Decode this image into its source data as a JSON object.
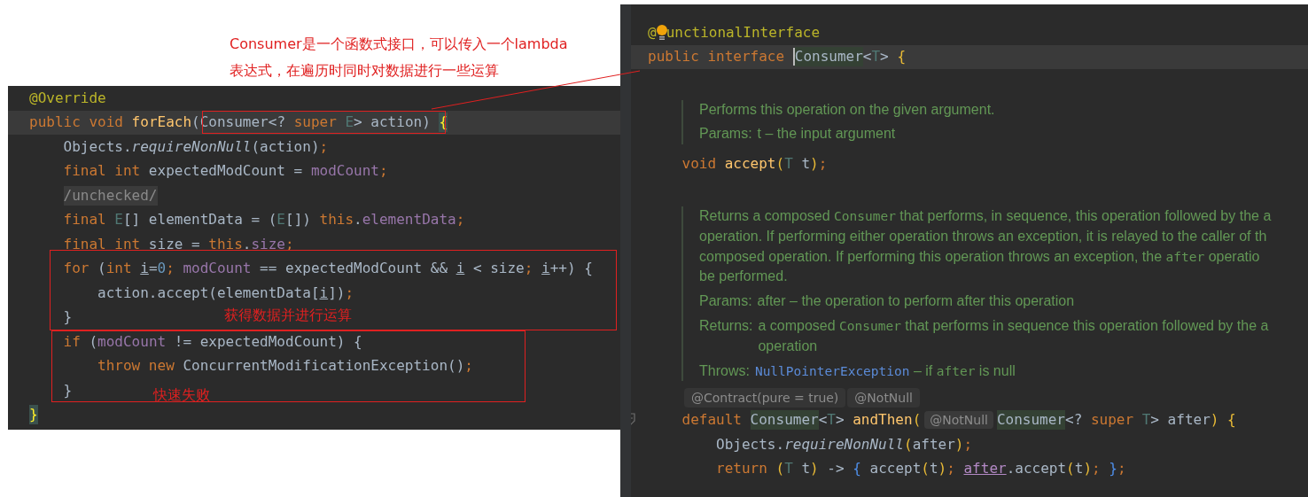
{
  "annotations": [
    {
      "lines": [
        "Consumer是一个函数式接口，可以传入一个lambda",
        "表达式，在遍历时同时对数据进行一些运算"
      ]
    },
    {
      "lines": [
        "获得数据并进行运算"
      ]
    },
    {
      "lines": [
        "快速失败"
      ]
    }
  ],
  "left_editor": {
    "lines": [
      {
        "current": false,
        "tokens": [
          {
            "kind": "ann",
            "text": "@Override"
          }
        ]
      },
      {
        "current": true,
        "tokens": [
          {
            "kind": "kw",
            "text": "public "
          },
          {
            "kind": "kw",
            "text": "void "
          },
          {
            "kind": "fn",
            "text": "forEach"
          },
          {
            "kind": "plain",
            "text": "(Consumer<? "
          },
          {
            "kind": "kw",
            "text": "super "
          },
          {
            "kind": "tparam",
            "text": "E"
          },
          {
            "kind": "plain",
            "text": "> action) "
          },
          {
            "kind": "brace_match",
            "text": "{"
          }
        ]
      },
      {
        "current": false,
        "tokens": [
          {
            "kind": "plain",
            "text": "    Objects."
          },
          {
            "kind": "italic",
            "text": "requireNonNull"
          },
          {
            "kind": "plain",
            "text": "(action)"
          },
          {
            "kind": "semi",
            "text": ";"
          }
        ]
      },
      {
        "current": false,
        "tokens": [
          {
            "kind": "kw",
            "text": "    final "
          },
          {
            "kind": "kw",
            "text": "int "
          },
          {
            "kind": "plain",
            "text": "expectedModCount = "
          },
          {
            "kind": "field",
            "text": "modCount"
          },
          {
            "kind": "semi",
            "text": ";"
          }
        ]
      },
      {
        "current": false,
        "tokens": [
          {
            "kind": "folded",
            "text": "/unchecked/"
          }
        ]
      },
      {
        "current": false,
        "tokens": [
          {
            "kind": "kw",
            "text": "    final "
          },
          {
            "kind": "tparam",
            "text": "E"
          },
          {
            "kind": "plain",
            "text": "[] elementData = ("
          },
          {
            "kind": "tparam",
            "text": "E"
          },
          {
            "kind": "plain",
            "text": "[]) "
          },
          {
            "kind": "kw",
            "text": "this"
          },
          {
            "kind": "plain",
            "text": "."
          },
          {
            "kind": "field",
            "text": "elementData"
          },
          {
            "kind": "semi",
            "text": ";"
          }
        ]
      },
      {
        "current": false,
        "tokens": [
          {
            "kind": "kw",
            "text": "    final "
          },
          {
            "kind": "kw",
            "text": "int "
          },
          {
            "kind": "plain",
            "text": "size = "
          },
          {
            "kind": "kw",
            "text": "this"
          },
          {
            "kind": "plain",
            "text": "."
          },
          {
            "kind": "field",
            "text": "size"
          },
          {
            "kind": "semi",
            "text": ";"
          }
        ]
      },
      {
        "current": false,
        "tokens": [
          {
            "kind": "kw",
            "text": "    for "
          },
          {
            "kind": "plain",
            "text": "("
          },
          {
            "kind": "kw",
            "text": "int "
          },
          {
            "kind": "var_u",
            "text": "i"
          },
          {
            "kind": "plain",
            "text": "="
          },
          {
            "kind": "num",
            "text": "0"
          },
          {
            "kind": "semi",
            "text": "; "
          },
          {
            "kind": "field",
            "text": "modCount"
          },
          {
            "kind": "plain",
            "text": " == expectedModCount && "
          },
          {
            "kind": "var_u",
            "text": "i"
          },
          {
            "kind": "plain",
            "text": " < size"
          },
          {
            "kind": "semi",
            "text": "; "
          },
          {
            "kind": "var_u",
            "text": "i"
          },
          {
            "kind": "plain",
            "text": "++) {"
          }
        ]
      },
      {
        "current": false,
        "tokens": [
          {
            "kind": "plain",
            "text": "        action.accept(elementData["
          },
          {
            "kind": "var_u",
            "text": "i"
          },
          {
            "kind": "plain",
            "text": "])"
          },
          {
            "kind": "semi",
            "text": ";"
          }
        ]
      },
      {
        "current": false,
        "tokens": [
          {
            "kind": "plain",
            "text": "    }"
          }
        ]
      },
      {
        "current": false,
        "tokens": [
          {
            "kind": "kw",
            "text": "    if "
          },
          {
            "kind": "plain",
            "text": "("
          },
          {
            "kind": "field",
            "text": "modCount"
          },
          {
            "kind": "plain",
            "text": " != expectedModCount) {"
          }
        ]
      },
      {
        "current": false,
        "tokens": [
          {
            "kind": "kw",
            "text": "        throw "
          },
          {
            "kind": "kw",
            "text": "new "
          },
          {
            "kind": "plain",
            "text": "ConcurrentModificationException()"
          },
          {
            "kind": "semi",
            "text": ";"
          }
        ]
      },
      {
        "current": false,
        "tokens": [
          {
            "kind": "plain",
            "text": "    }"
          }
        ]
      },
      {
        "current": false,
        "tokens": [
          {
            "kind": "brace_match",
            "text": "}"
          }
        ]
      }
    ]
  },
  "right_editor": {
    "items": [
      {
        "kind": "code",
        "current": false,
        "tokens": [
          {
            "kind": "ann",
            "text": "@"
          },
          {
            "kind": "bulb"
          },
          {
            "kind": "ann",
            "text": "unctionalInterface"
          }
        ]
      },
      {
        "kind": "code",
        "current": true,
        "tokens": [
          {
            "kind": "kw",
            "text": "public "
          },
          {
            "kind": "kw",
            "text": "interface "
          },
          {
            "kind": "caret"
          },
          {
            "kind": "highlight",
            "text": "Consumer"
          },
          {
            "kind": "plain",
            "text": "<"
          },
          {
            "kind": "tparam",
            "text": "T"
          },
          {
            "kind": "plain",
            "text": "> "
          },
          {
            "kind": "brace_y",
            "text": "{"
          }
        ]
      },
      {
        "kind": "blank"
      },
      {
        "kind": "doc",
        "rows": [
          {
            "lines": [
              [
                {
                  "kind": "text",
                  "text": "Performs this operation on the given argument."
                }
              ]
            ]
          },
          {
            "label": "Params:",
            "lines": [
              [
                {
                  "kind": "text",
                  "text": "t – the input argument"
                }
              ]
            ]
          }
        ]
      },
      {
        "kind": "code",
        "current": false,
        "tokens": [
          {
            "kind": "kw",
            "text": "    void "
          },
          {
            "kind": "fn",
            "text": "accept"
          },
          {
            "kind": "brace_y",
            "text": "("
          },
          {
            "kind": "tparam",
            "text": "T"
          },
          {
            "kind": "plain",
            "text": " t"
          },
          {
            "kind": "brace_y",
            "text": ")"
          },
          {
            "kind": "semi",
            "text": ";"
          }
        ]
      },
      {
        "kind": "blank"
      },
      {
        "kind": "doc",
        "rows": [
          {
            "lines": [
              [
                {
                  "kind": "text",
                  "text": "Returns a composed "
                },
                {
                  "kind": "code",
                  "text": "Consumer"
                },
                {
                  "kind": "text",
                  "text": " that performs, in sequence, this operation followed by the a"
                }
              ],
              [
                {
                  "kind": "text",
                  "text": "operation. If performing either operation throws an exception, it is relayed to the caller of th"
                }
              ],
              [
                {
                  "kind": "text",
                  "text": "composed operation. If performing this operation throws an exception, the "
                },
                {
                  "kind": "code",
                  "text": "after"
                },
                {
                  "kind": "text",
                  "text": " operatio"
                }
              ],
              [
                {
                  "kind": "text",
                  "text": "be performed."
                }
              ]
            ]
          },
          {
            "label": "Params:",
            "lines": [
              [
                {
                  "kind": "text",
                  "text": "after – the operation to perform after this operation"
                }
              ]
            ]
          },
          {
            "label": "Returns:",
            "lines": [
              [
                {
                  "kind": "text",
                  "text": "a composed "
                },
                {
                  "kind": "code",
                  "text": "Consumer"
                },
                {
                  "kind": "text",
                  "text": " that performs in sequence this operation followed by the a"
                }
              ],
              [
                {
                  "kind": "text",
                  "text": "operation"
                }
              ]
            ]
          },
          {
            "label": "Throws:",
            "lines": [
              [
                {
                  "kind": "link",
                  "text": "NullPointerException"
                },
                {
                  "kind": "text",
                  "text": " – if "
                },
                {
                  "kind": "code",
                  "text": "after"
                },
                {
                  "kind": "text",
                  "text": " is null"
                }
              ]
            ]
          }
        ]
      },
      {
        "kind": "hints",
        "hints": [
          "@Contract(pure = true)",
          "@NotNull"
        ]
      },
      {
        "kind": "code",
        "current": false,
        "fold": true,
        "tokens": [
          {
            "kind": "kw",
            "text": "    default "
          },
          {
            "kind": "highlight",
            "text": "Consumer"
          },
          {
            "kind": "plain",
            "text": "<"
          },
          {
            "kind": "tparam",
            "text": "T"
          },
          {
            "kind": "plain",
            "text": "> "
          },
          {
            "kind": "fn",
            "text": "andThen"
          },
          {
            "kind": "brace_y",
            "text": "("
          },
          {
            "kind": "hint",
            "text": "@NotNull"
          },
          {
            "kind": "highlight",
            "text": "Consumer"
          },
          {
            "kind": "plain",
            "text": "<? "
          },
          {
            "kind": "kw",
            "text": "super "
          },
          {
            "kind": "tparam",
            "text": "T"
          },
          {
            "kind": "plain",
            "text": "> after"
          },
          {
            "kind": "brace_y",
            "text": ") {"
          }
        ]
      },
      {
        "kind": "code",
        "current": false,
        "tokens": [
          {
            "kind": "plain",
            "text": "        Objects."
          },
          {
            "kind": "italic",
            "text": "requireNonNull"
          },
          {
            "kind": "brace_y",
            "text": "("
          },
          {
            "kind": "plain",
            "text": "after"
          },
          {
            "kind": "brace_y",
            "text": ")"
          },
          {
            "kind": "semi",
            "text": ";"
          }
        ]
      },
      {
        "kind": "code",
        "current": false,
        "tokens": [
          {
            "kind": "kw",
            "text": "        return "
          },
          {
            "kind": "brace_y",
            "text": "("
          },
          {
            "kind": "tparam",
            "text": "T"
          },
          {
            "kind": "plain",
            "text": " t"
          },
          {
            "kind": "brace_y",
            "text": ")"
          },
          {
            "kind": "plain",
            "text": " -> "
          },
          {
            "kind": "brace_blue",
            "text": "{"
          },
          {
            "kind": "plain",
            "text": " accept"
          },
          {
            "kind": "brace_y",
            "text": "("
          },
          {
            "kind": "plain",
            "text": "t"
          },
          {
            "kind": "brace_y",
            "text": ")"
          },
          {
            "kind": "semi",
            "text": "; "
          },
          {
            "kind": "ref_u",
            "text": "after"
          },
          {
            "kind": "plain",
            "text": ".accept"
          },
          {
            "kind": "brace_y",
            "text": "("
          },
          {
            "kind": "plain",
            "text": "t"
          },
          {
            "kind": "brace_y",
            "text": ")"
          },
          {
            "kind": "semi",
            "text": "; "
          },
          {
            "kind": "brace_blue",
            "text": "}"
          },
          {
            "kind": "semi",
            "text": ";"
          }
        ]
      }
    ]
  }
}
